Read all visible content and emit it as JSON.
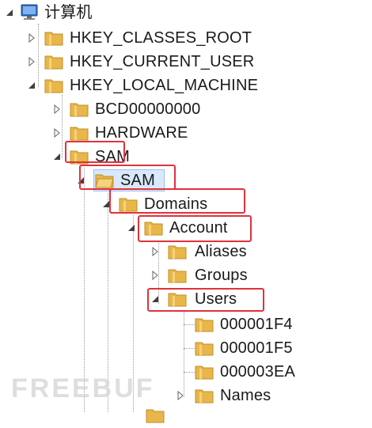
{
  "tree": {
    "root": {
      "label": "计算机",
      "icon": "computer-icon"
    },
    "hkcr": {
      "label": "HKEY_CLASSES_ROOT",
      "icon": "folder-icon"
    },
    "hkcu": {
      "label": "HKEY_CURRENT_USER",
      "icon": "folder-icon"
    },
    "hklm": {
      "label": "HKEY_LOCAL_MACHINE",
      "icon": "folder-icon"
    },
    "bcd": {
      "label": "BCD00000000",
      "icon": "folder-icon"
    },
    "hardware": {
      "label": "HARDWARE",
      "icon": "folder-icon"
    },
    "sam": {
      "label": "SAM",
      "icon": "folder-icon"
    },
    "sam_sub": {
      "label": "SAM",
      "icon": "open-folder-icon"
    },
    "domains": {
      "label": "Domains",
      "icon": "folder-icon"
    },
    "account": {
      "label": "Account",
      "icon": "folder-icon"
    },
    "aliases": {
      "label": "Aliases",
      "icon": "folder-icon"
    },
    "groups": {
      "label": "Groups",
      "icon": "folder-icon"
    },
    "users": {
      "label": "Users",
      "icon": "folder-icon"
    },
    "u1": {
      "label": "000001F4",
      "icon": "folder-icon"
    },
    "u2": {
      "label": "000001F5",
      "icon": "folder-icon"
    },
    "u3": {
      "label": "000003EA",
      "icon": "folder-icon"
    },
    "names": {
      "label": "Names",
      "icon": "folder-icon"
    }
  },
  "watermark": {
    "text": "FREEBUF"
  },
  "colors": {
    "highlight": "#e0323c",
    "selection": "#d9e8fb",
    "folder": "#e8b64a"
  }
}
